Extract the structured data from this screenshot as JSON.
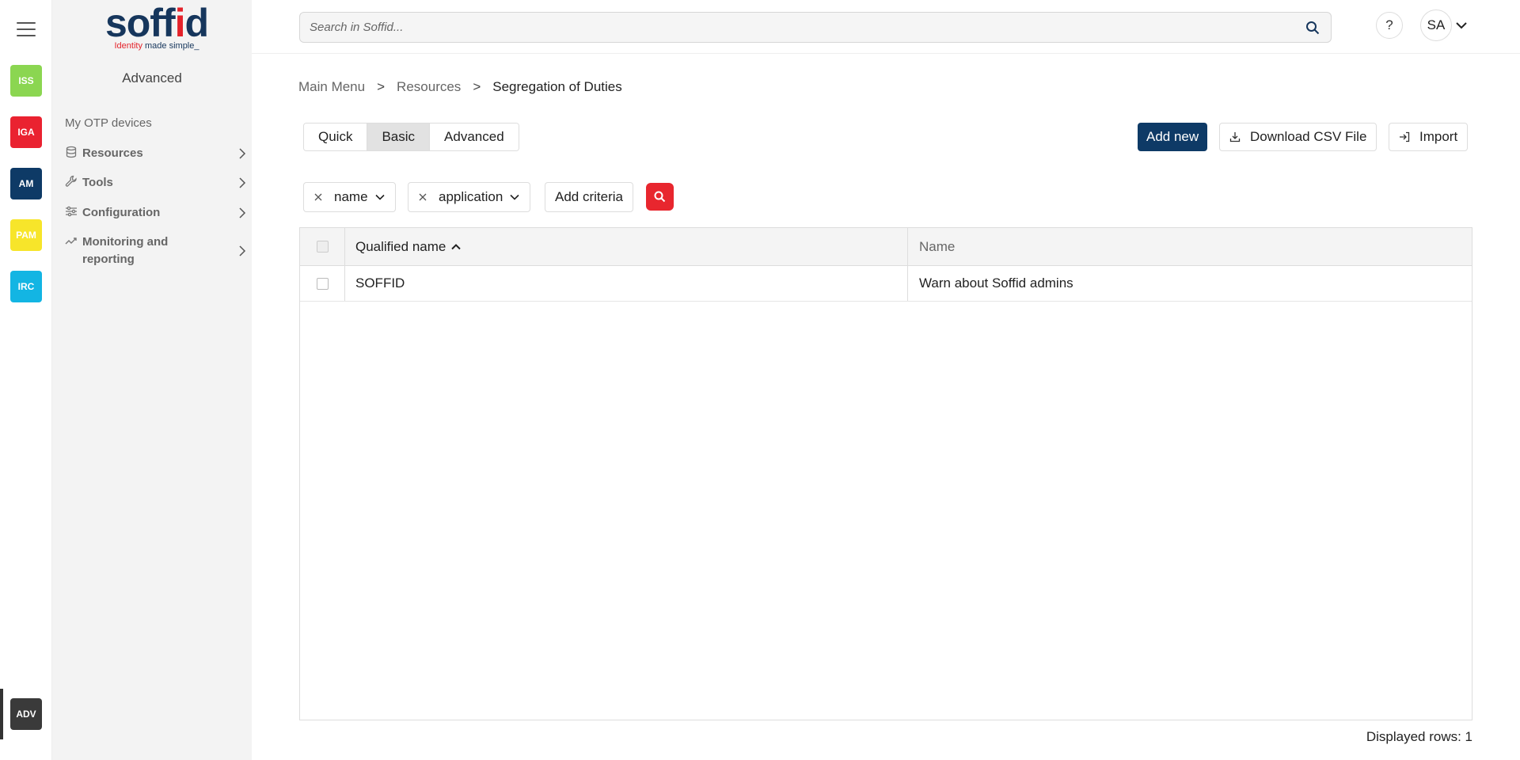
{
  "rail": {
    "apps": [
      {
        "label": "ISS",
        "color": "#8bd651"
      },
      {
        "label": "IGA",
        "color": "#ea2230"
      },
      {
        "label": "AM",
        "color": "#0e3a66"
      },
      {
        "label": "PAM",
        "color": "#f7e52a"
      },
      {
        "label": "IRC",
        "color": "#13b5e3"
      }
    ],
    "active_app": {
      "label": "ADV",
      "color": "#3a3a3a"
    }
  },
  "sidebar": {
    "logo": {
      "word_part1": "soff",
      "word_i": "i",
      "word_part2": "d",
      "tag_part1": "Identity",
      "tag_part2": " made simple_"
    },
    "title": "Advanced",
    "items": [
      {
        "label": "My OTP devices",
        "icon": "none"
      },
      {
        "label": "Resources",
        "icon": "database-icon"
      },
      {
        "label": "Tools",
        "icon": "wrench-icon"
      },
      {
        "label": "Configuration",
        "icon": "sliders-icon"
      },
      {
        "label": "Monitoring and reporting",
        "icon": "chart-line-icon"
      }
    ]
  },
  "topbar": {
    "search_placeholder": "Search in Soffid...",
    "help_label": "?",
    "user_initials": "SA"
  },
  "breadcrumb": {
    "items": [
      "Main Menu",
      "Resources"
    ],
    "separator": ">",
    "current": "Segregation of Duties"
  },
  "tabs": [
    {
      "label": "Quick",
      "active": false
    },
    {
      "label": "Basic",
      "active": true
    },
    {
      "label": "Advanced",
      "active": false
    }
  ],
  "actions": {
    "add_new": "Add new",
    "download_csv": "Download CSV File",
    "import": "Import"
  },
  "filters": {
    "chips": [
      "name",
      "application"
    ],
    "add_criteria": "Add criteria"
  },
  "table": {
    "columns": [
      "Qualified name",
      "Name"
    ],
    "sort": {
      "column": "Qualified name",
      "direction": "ascending"
    },
    "rows": [
      {
        "qualified_name": "SOFFID",
        "name": "Warn about Soffid admins"
      }
    ]
  },
  "footer": {
    "displayed_rows": "Displayed rows: 1"
  },
  "colors": {
    "brand_navy": "#0e3a66",
    "brand_red": "#e8262e"
  }
}
